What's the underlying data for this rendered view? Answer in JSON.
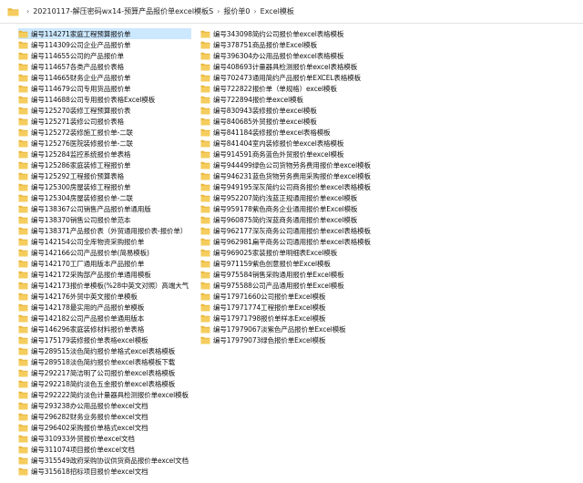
{
  "address_bar": {
    "crumbs": [
      "20210117-解压密码wx14-预算产品报价单excel模板S",
      "报价单0",
      "Excel模板"
    ],
    "separator": "›"
  },
  "colors": {
    "folder_body": "#e8b43a",
    "folder_tab": "#f5cd5e",
    "selection": "#cce8ff"
  },
  "icon": "folder-icon",
  "folders": [
    "编号114271家庭工程预算报价单",
    "编号114309公司企业产品报价单",
    "编号114655公司的产品报价单",
    "编号114657各类产品报价表格",
    "编号114665财务企业产品报价单",
    "编号114679公司专用货品报价单",
    "编号114688公司专用报价表格Excel模板",
    "编号125270装修工程预算报价表",
    "编号125271装修公司报价表格",
    "编号125272装修施工报价单-二联",
    "编号125276医院装修报价单-二联",
    "编号125284监控系统报价单表格",
    "编号125286家庭装修工程报价单",
    "编号125292工程报价预算表格",
    "编号125300房屋装修工程报价单",
    "编号125304房屋装修报价单-二联",
    "编号138367公司销售产品报价单通用版",
    "编号138370销售公司报价单范本",
    "编号138371产品报价表（外贸通用报价表-报价单）",
    "编号142154公司全库物资采购报价单",
    "编号142166公司产品报价单(简易模板)",
    "编号142170工厂通用版本产品报价单",
    "编号142172采购部产品报价单通用模板",
    "编号142173报价单模板(%28中英文对照）高端大气",
    "编号142176外贸中英文报价单模板",
    "编号142178最实用的产品报价单模板",
    "编号142182公司产品报价单通用版本",
    "编号146296家庭装修材料报价单表格",
    "编号175179装修报价单表格excel模板",
    "编号289515淡色简约报价单格式excel表格模板",
    "编号289518淡色简约报价单excel表格模板下载",
    "编号292217简洁明了公司报价单excel表格模板",
    "编号292218简约淡色五金报价单excel表格模板",
    "编号292222简约淡色计量器具检测报价单excel模板",
    "编号293238办公用品报价单excel文档",
    "编号296282财务业务报价单excel文档",
    "编号296402采购报价单格式excel文档",
    "编号310933外贸报价单excel文档",
    "编号311074项目报价单excel文档",
    "编号315549政府采购协议供货商品报价单excel文档",
    "编号315618招标项目报价单excel文档",
    "编号343098简约公司报价单excel表格模板",
    "编号378751商品报价单Excel模板",
    "编号396304办公用品报价单excel表格模板",
    "编号408693计量器具检测报价单excel表格模板",
    "编号702473通用简约产品报价单EXCEL表格模板",
    "编号722822报价单（单规格）excel模板",
    "编号722894报价单excel模板",
    "编号830943装修报价单excel模板",
    "编号840685外贸报价单excel模板",
    "编号841184装修报价单excel表格模板",
    "编号841404室内装修报价单excel表格模板",
    "编号914591商务蓝色外贸报价单excel模板",
    "编号944499绿色公司货物劳务费用报价单excel模板",
    "编号946231蓝色货物劳务费用采购报价单excel模板",
    "编号949195深灰简约公司商务报价单excel表格模板",
    "编号952207简约浅蓝正规通用报价单excel模板",
    "编号959178紫色商务企业通用报价单Excel模板",
    "编号960875简约深蓝商务通用报价单excel模板",
    "编号962177深灰商务公司通用报价单excel表格模板",
    "编号962981扁平商务公司通用报价单excel表格模板",
    "编号969025家装报价单明细表Excel模板",
    "编号971159紫色创意报价单Excel模板",
    "编号975584销售采购通用报价单Excel模板",
    "编号975588公司产品通用报价单Excel模板",
    "编号17971660公司报价单Excel模板",
    "编号17971774工程报价单Excel模板",
    "编号17971798报价单样本Excel模板",
    "编号17979067淡紫色产品报价单Excel模板",
    "编号17979073绿色报价单Excel模板"
  ]
}
